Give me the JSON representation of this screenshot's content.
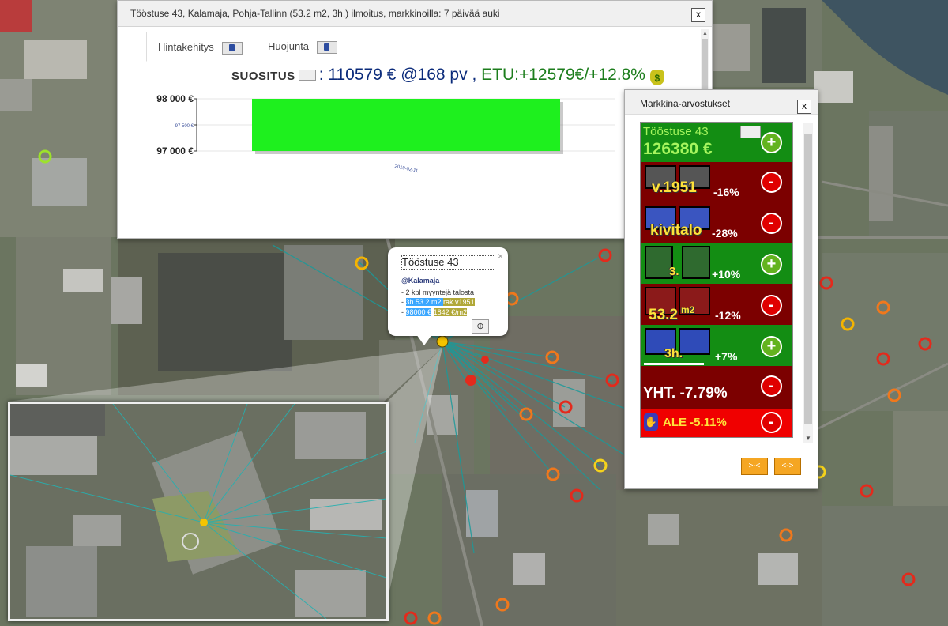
{
  "listing_window": {
    "title": "Tööstuse 43, Kalamaja, Pohja-Tallinn (53.2 m2, 3h.) ilmoitus, markkinoilla: 7 päivää auki",
    "close_label": "x",
    "tabs": [
      {
        "label": "Hintakehitys",
        "active": true
      },
      {
        "label": "Huojunta",
        "active": false
      }
    ],
    "recommendation": {
      "label": "SUOSITUS",
      "separator": ":",
      "price_text": "110579 € @168 pv",
      "comma": ",",
      "gain_text": "ETU:+12579€/+12.8%",
      "money_icon": "money-bag-icon"
    }
  },
  "chart_data": {
    "type": "bar",
    "categories": [
      "2019-02-11"
    ],
    "values": [
      98000
    ],
    "yticks": [
      "98 000 €",
      "97 500 €",
      "97 000 €"
    ],
    "ylim": [
      97000,
      98000
    ],
    "bar_color": "#1ef01e",
    "grid": true
  },
  "popup": {
    "title": "Tööstuse 43",
    "close": "×",
    "location": "@Kalamaja",
    "line1": "- 2 kpl myyntejä talosta",
    "line2_prefix": "- ",
    "line2_a": "3h",
    "line2_b": " 53.2 m2 ",
    "line2_c": "rak.v1951",
    "line3_prefix": "- ",
    "line3_a": "98000 €",
    "line3_sep": " ",
    "line3_b": "1842 €/m2",
    "zoom_icon": "zoom-in-icon"
  },
  "market_window": {
    "title": "Markkina-arvostukset",
    "close_label": "x",
    "rows": [
      {
        "name": "Tööstuse 43",
        "value": "126380 €",
        "action": "+"
      },
      {
        "label": "v.1951",
        "pct": "-16%",
        "action": "-"
      },
      {
        "label": "kivitalo",
        "pct": "-28%",
        "action": "-"
      },
      {
        "label": "3.",
        "pct": "+10%",
        "action": "+"
      },
      {
        "label": "53.2",
        "label_sup": "m2",
        "pct": "-12%",
        "action": "-"
      },
      {
        "label": "3h.",
        "pct": "+7%",
        "action": "+"
      },
      {
        "label": "YHT. -7.79%",
        "action": "-"
      },
      {
        "label": "ALE -5.11%",
        "action": "-"
      }
    ],
    "buttons": [
      ">-<",
      "<->"
    ]
  },
  "colors": {
    "green_row": "#138d13",
    "red_row": "#7c0000",
    "bright_red_row": "#f00000",
    "highlight_yellow": "#ffe23a",
    "recommendation_blue": "#0a2a7a",
    "gain_green": "#1c7d1c"
  }
}
